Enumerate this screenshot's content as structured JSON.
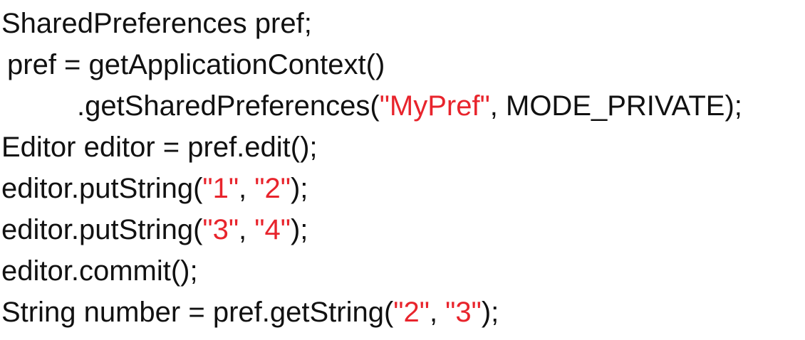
{
  "code": {
    "line1": {
      "text": "SharedPreferences pref;"
    },
    "line2": {
      "text": "pref = getApplicationContext()"
    },
    "line3": {
      "before": ".getSharedPreferences(",
      "str1": "\"MyPref\"",
      "after": ", MODE_PRIVATE);"
    },
    "line4": {
      "text": "Editor editor = pref.edit();"
    },
    "line5": {
      "before": "editor.putString(",
      "str1": "\"1\"",
      "sep": ", ",
      "str2": "\"2\"",
      "after": ");"
    },
    "line6": {
      "before": "editor.putString(",
      "str1": "\"3\"",
      "sep": ", ",
      "str2": "\"4\"",
      "after": ");"
    },
    "line7": {
      "text": "editor.commit();"
    },
    "line8": {
      "before": "String number = pref.getString(",
      "str1": "\"2\"",
      "sep": ", ",
      "str2": "\"3\"",
      "after": ");"
    }
  },
  "colors": {
    "code_text": "#111111",
    "string_literal": "#e8242c",
    "background": "#ffffff"
  }
}
